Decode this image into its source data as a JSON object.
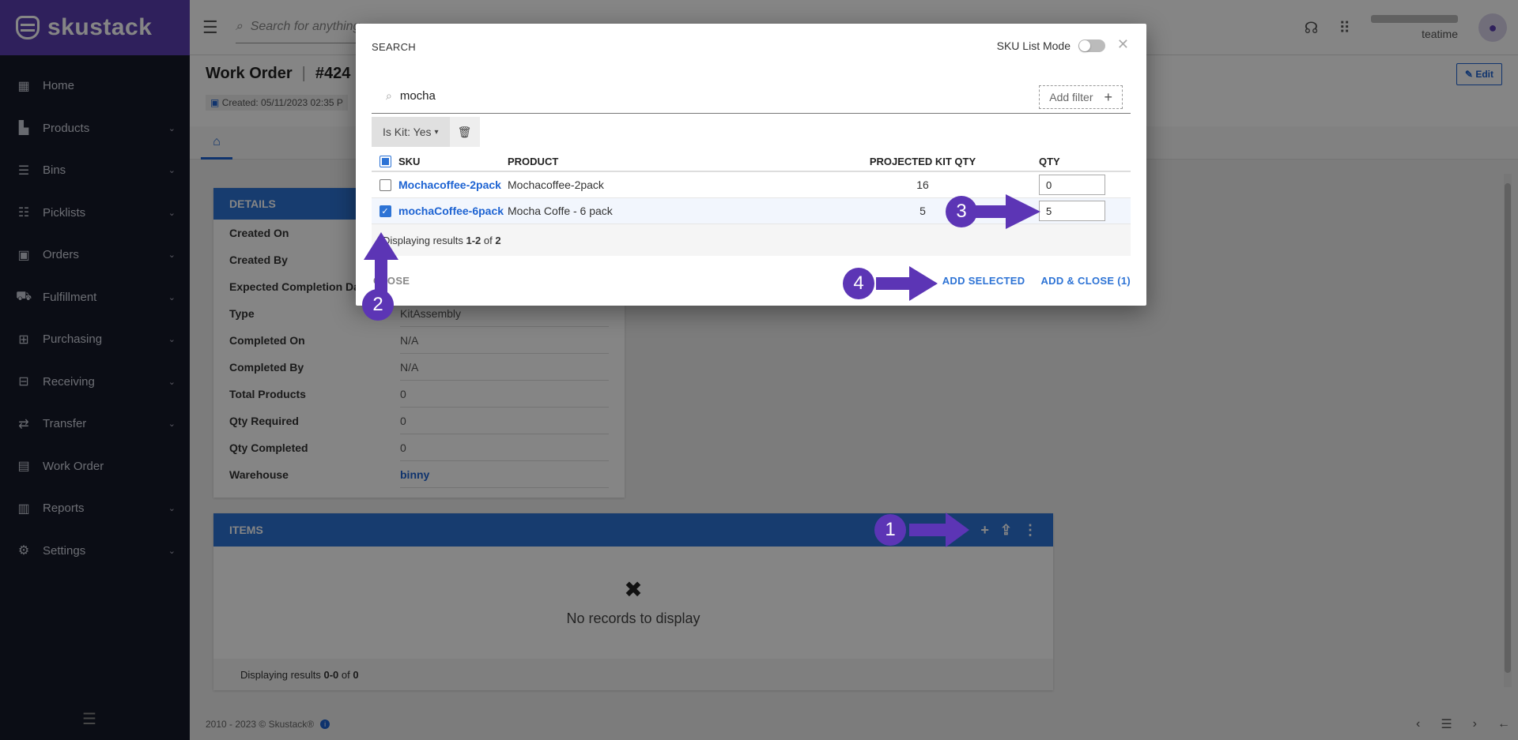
{
  "brand": {
    "name": "skustack"
  },
  "sidebar": {
    "items": [
      {
        "label": "Home",
        "icon": "dashboard-icon",
        "glyph": "▦",
        "chevron": false
      },
      {
        "label": "Products",
        "icon": "products-icon",
        "glyph": "▙",
        "chevron": true
      },
      {
        "label": "Bins",
        "icon": "bins-icon",
        "glyph": "☰",
        "chevron": true
      },
      {
        "label": "Picklists",
        "icon": "picklists-icon",
        "glyph": "☷",
        "chevron": true
      },
      {
        "label": "Orders",
        "icon": "orders-icon",
        "glyph": "▣",
        "chevron": true
      },
      {
        "label": "Fulfillment",
        "icon": "truck-icon",
        "glyph": "⛟",
        "chevron": true
      },
      {
        "label": "Purchasing",
        "icon": "purchasing-icon",
        "glyph": "⊞",
        "chevron": true
      },
      {
        "label": "Receiving",
        "icon": "receiving-icon",
        "glyph": "⊟",
        "chevron": true
      },
      {
        "label": "Transfer",
        "icon": "transfer-icon",
        "glyph": "⇄",
        "chevron": true
      },
      {
        "label": "Work Order",
        "icon": "work-order-icon",
        "glyph": "▤",
        "chevron": false
      },
      {
        "label": "Reports",
        "icon": "reports-icon",
        "glyph": "▥",
        "chevron": true
      },
      {
        "label": "Settings",
        "icon": "gear-icon",
        "glyph": "⚙",
        "chevron": true
      }
    ]
  },
  "topbar": {
    "search_placeholder": "Search for anything",
    "user_name": "teatime"
  },
  "header": {
    "title": "Work Order",
    "number": "#424",
    "created": "Created: 05/11/2023 02:35 P",
    "edit_label": "Edit"
  },
  "details": {
    "title": "DETAILS",
    "rows": [
      {
        "label": "Created On",
        "value": ""
      },
      {
        "label": "Created By",
        "value": ""
      },
      {
        "label": "Expected Completion Date",
        "value": ""
      },
      {
        "label": "Type",
        "value": "KitAssembly"
      },
      {
        "label": "Completed On",
        "value": "N/A"
      },
      {
        "label": "Completed By",
        "value": "N/A"
      },
      {
        "label": "Total Products",
        "value": "0"
      },
      {
        "label": "Qty Required",
        "value": "0"
      },
      {
        "label": "Qty Completed",
        "value": "0"
      },
      {
        "label": "Warehouse",
        "value": "binny",
        "link": true
      }
    ]
  },
  "items": {
    "title": "ITEMS",
    "empty_text": "No records to display",
    "results_prefix": "Displaying results ",
    "results_range": "0-0",
    "results_of": " of ",
    "results_total": "0"
  },
  "footer": {
    "copyright": "2010 - 2023 © Skustack®"
  },
  "modal": {
    "title": "SEARCH",
    "mode_label": "SKU List Mode",
    "search_value": "mocha",
    "add_filter_label": "Add filter",
    "chip_label": "Is Kit: Yes",
    "columns": {
      "sku": "SKU",
      "product": "PRODUCT",
      "projected": "PROJECTED KIT QTY",
      "qty": "QTY"
    },
    "rows": [
      {
        "sku": "Mochacoffee-2pack",
        "product": "Mochacoffee-2pack",
        "projected": "16",
        "qty": "0",
        "selected": false
      },
      {
        "sku": "mochaCoffee-6pack",
        "product": "Mocha Coffe - 6 pack",
        "projected": "5",
        "qty": "5",
        "selected": true
      }
    ],
    "results_prefix": "Displaying results ",
    "results_range": "1-2",
    "results_of": " of ",
    "results_total": "2",
    "close_label": "CLOSE",
    "add_selected_label": "ADD SELECTED",
    "add_close_label": "ADD & CLOSE (1)"
  },
  "annotations": {
    "color": "#5c35b5",
    "steps": [
      "1",
      "2",
      "3",
      "4"
    ]
  }
}
